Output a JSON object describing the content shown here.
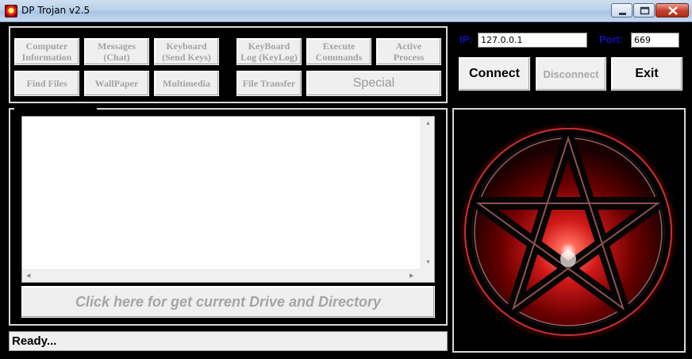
{
  "window": {
    "title": "DP Trojan v2.5"
  },
  "commands": [
    {
      "id": "computer-information",
      "label": "Computer\nInformation"
    },
    {
      "id": "messages-chat",
      "label": "Messages\n(Chat)"
    },
    {
      "id": "keyboard-send-keys",
      "label": "Keyboard\n(Send Keys)"
    },
    {
      "id": "keyboard-log",
      "label": "KeyBoard\nLog (KeyLog)"
    },
    {
      "id": "execute-commands",
      "label": "Execute\nCommands"
    },
    {
      "id": "active-process",
      "label": "Active\nProcess"
    },
    {
      "id": "find-files",
      "label": "Find Files"
    },
    {
      "id": "wallpaper",
      "label": "WallPaper"
    },
    {
      "id": "multimedia",
      "label": "Multimedia"
    },
    {
      "id": "file-transfer",
      "label": "File Transfer"
    },
    {
      "id": "special",
      "label": "Special"
    }
  ],
  "output": {
    "text": ""
  },
  "drive_button": {
    "label": "Click here for get current Drive and Directory"
  },
  "status": {
    "text": "Ready..."
  },
  "connection": {
    "ip_label": "IP:",
    "ip_value": "127.0.0.1",
    "port_label": "Port:",
    "port_value": "669"
  },
  "actions": {
    "connect": "Connect",
    "disconnect": "Disconnect",
    "exit": "Exit"
  },
  "colors": {
    "label_blue": "#1010b0",
    "pentagram_red": "#e0202a"
  },
  "image": {
    "icon": "pentagram-icon"
  }
}
